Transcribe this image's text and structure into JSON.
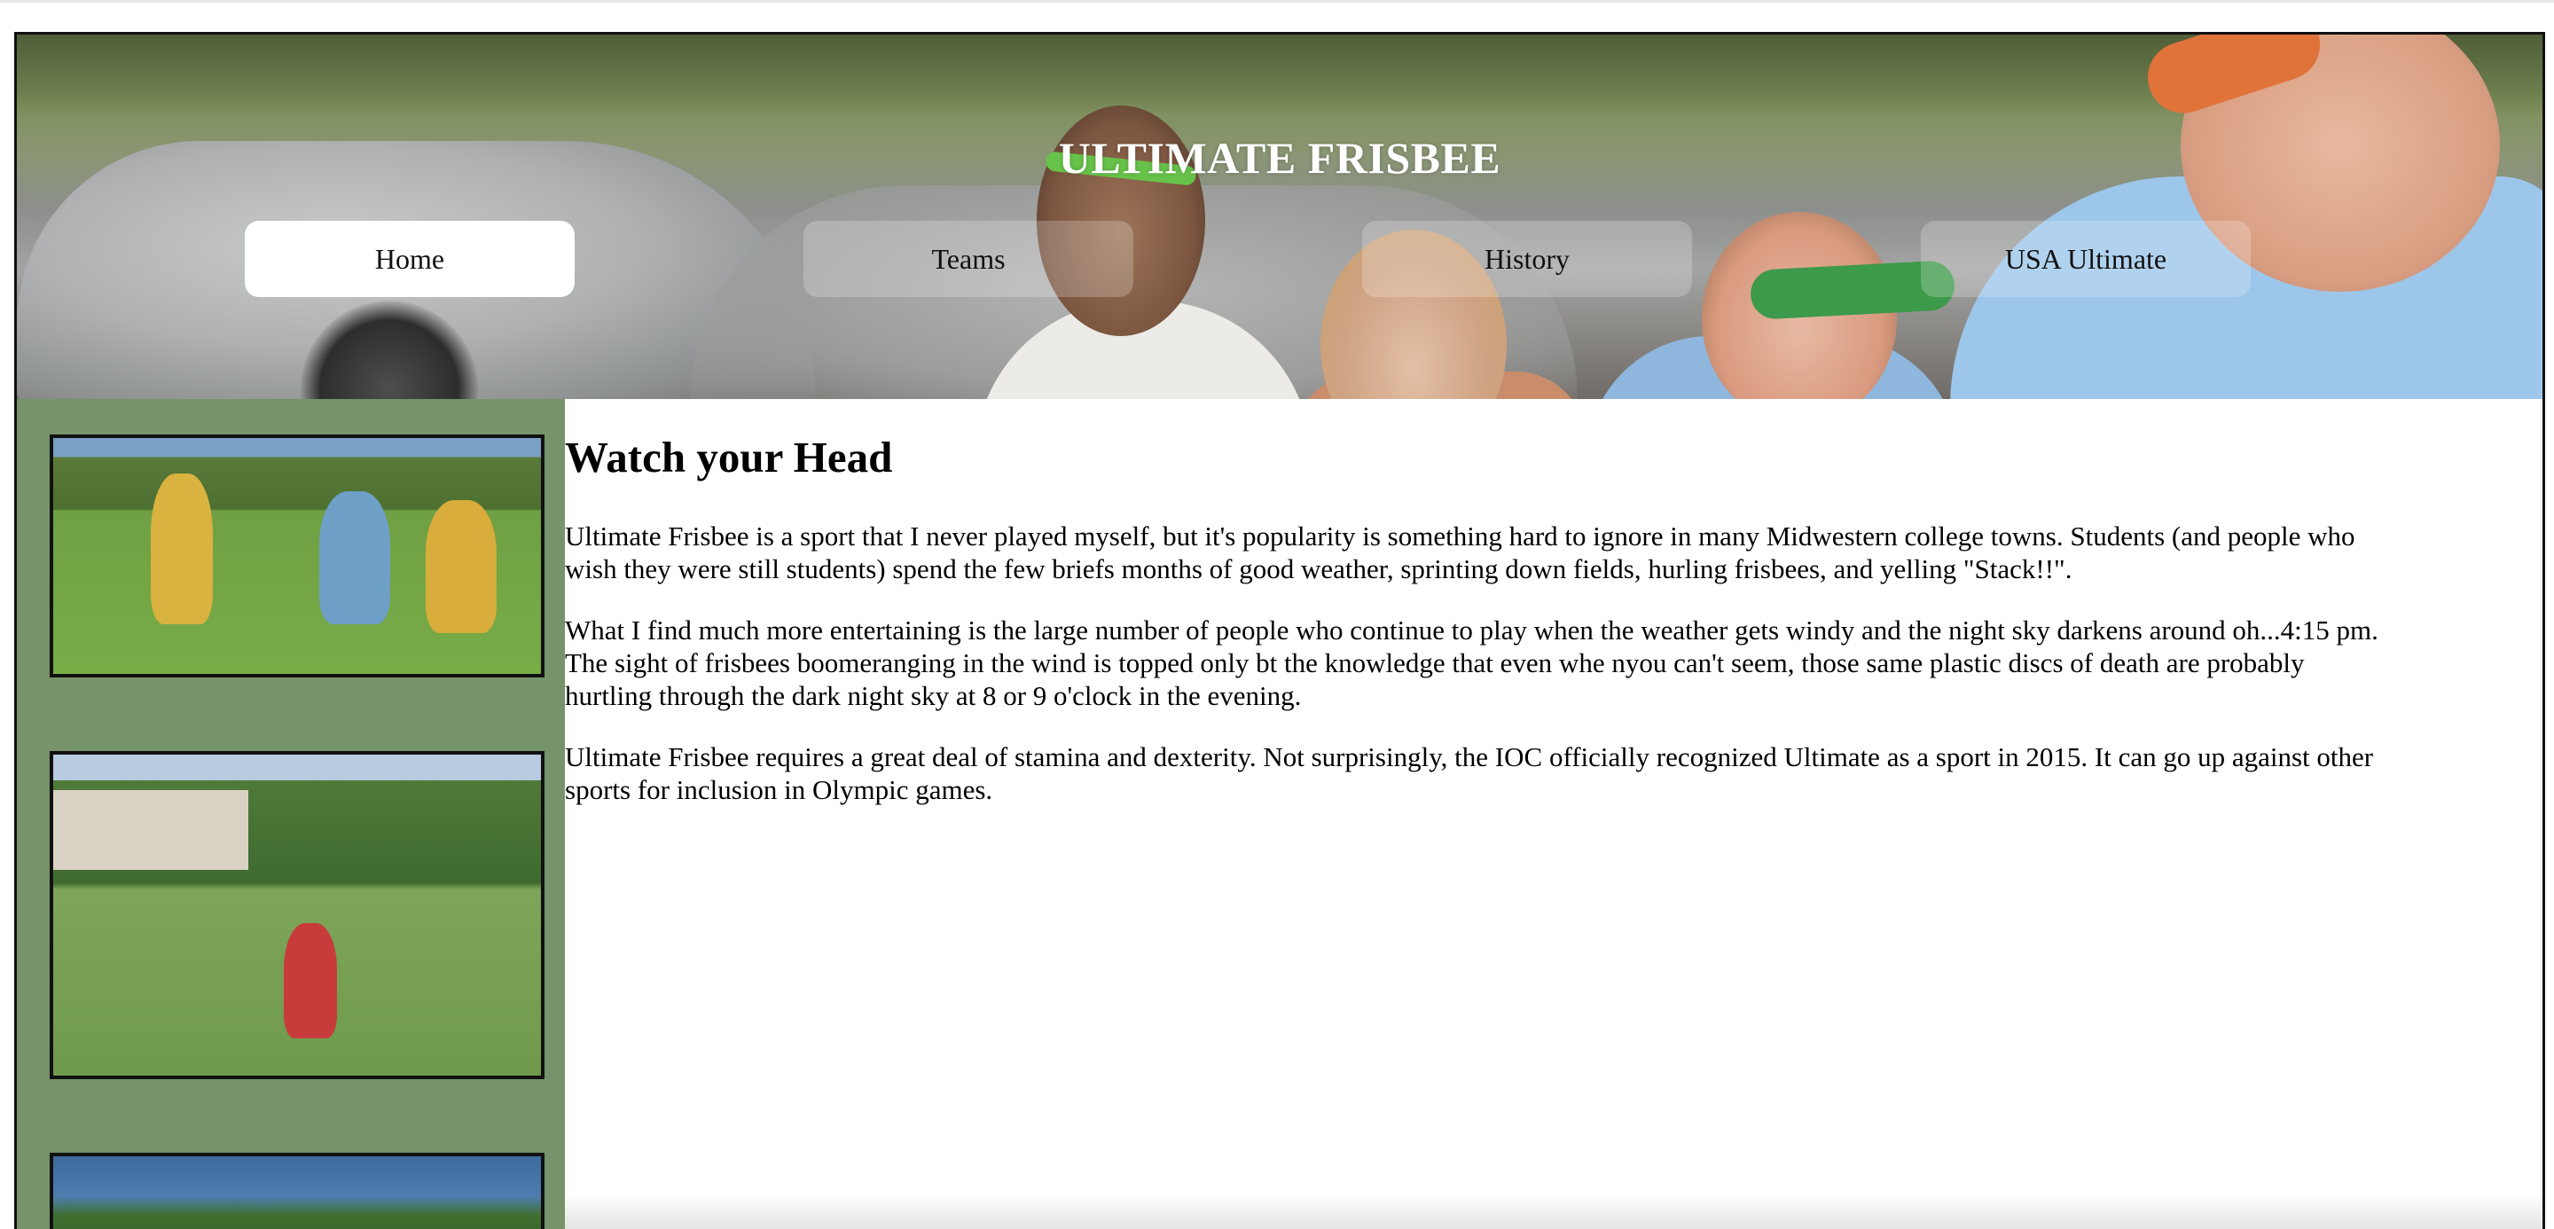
{
  "header": {
    "title": "ULTIMATE FRISBEE",
    "background_image": "ultimate-frisbee-players-photo"
  },
  "nav": {
    "items": [
      {
        "label": "Home",
        "active": true
      },
      {
        "label": "Teams",
        "active": false
      },
      {
        "label": "History",
        "active": false
      },
      {
        "label": "USA Ultimate",
        "active": false
      }
    ]
  },
  "sidebar": {
    "background_color": "#769369",
    "photos": [
      {
        "name": "frisbee-players-photo-1"
      },
      {
        "name": "frisbee-catch-photo-2"
      },
      {
        "name": "trees-photo-3"
      }
    ]
  },
  "main": {
    "heading": "Watch your Head",
    "paragraphs": [
      "Ultimate Frisbee is a sport that I never played myself, but it's popularity is something hard to ignore in many Midwestern college towns. Students (and people who wish they were still students) spend the few briefs months of good weather, sprinting down fields, hurling frisbees, and yelling \"Stack!!\".",
      "What I find much more entertaining is the large number of people who continue to play when the weather gets windy and the night sky darkens around oh...4:15 pm. The sight of frisbees boomeranging in the wind is topped only bt the knowledge that even whe nyou can't seem, those same plastic discs of death are probably hurtling through the dark night sky at 8 or 9 o'clock in the evening.",
      "Ultimate Frisbee requires a great deal of stamina and dexterity. Not surprisingly, the IOC officially recognized Ultimate as a sport in 2015. It can go up against other sports for inclusion in Olympic games."
    ]
  }
}
